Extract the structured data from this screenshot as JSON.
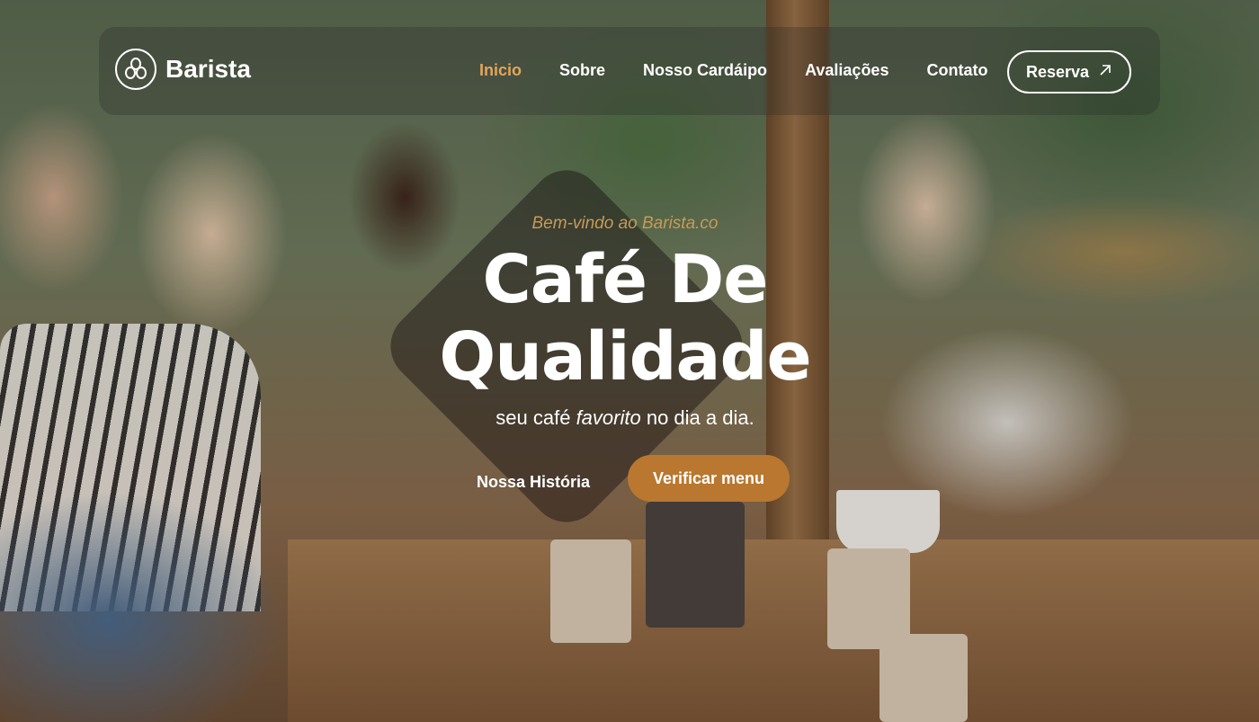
{
  "brand": {
    "name": "Barista",
    "logo_icon": "coffee-beans-logo-icon"
  },
  "nav": {
    "items": [
      {
        "label": "Inicio",
        "active": true
      },
      {
        "label": "Sobre",
        "active": false
      },
      {
        "label": "Nosso Cardáipo",
        "active": false
      },
      {
        "label": "Avaliações",
        "active": false
      },
      {
        "label": "Contato",
        "active": false
      }
    ],
    "reserve_label": "Reserva",
    "reserve_icon": "arrow-up-right-icon"
  },
  "hero": {
    "welcome": "Bem-vindo ao Barista.co",
    "title_line1": "Café De",
    "title_line2": "Qualidade",
    "subtitle_prefix": "seu café ",
    "subtitle_emphasis": "favorito",
    "subtitle_suffix": " no dia a dia.",
    "history_label": "Nossa História",
    "menu_label": "Verificar menu"
  },
  "colors": {
    "accent": "#e3a65a",
    "button": "#b9772f",
    "welcome": "#c89a58"
  }
}
